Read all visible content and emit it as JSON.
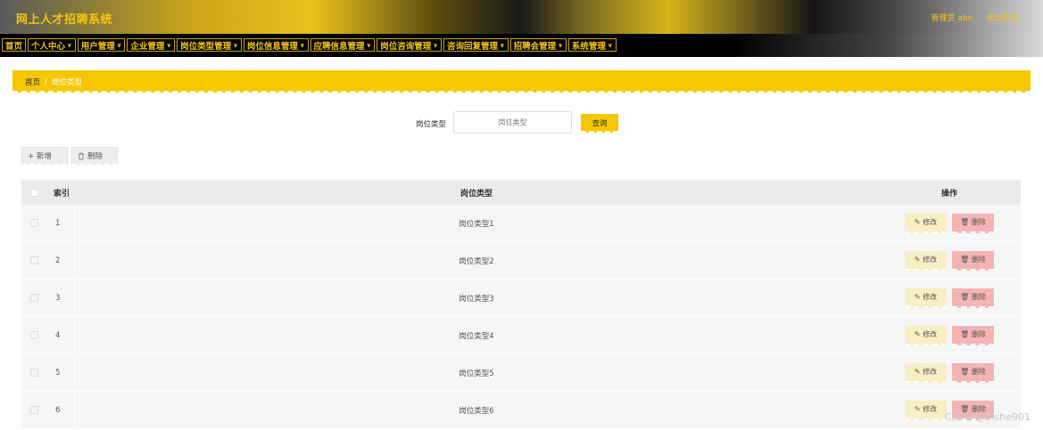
{
  "header": {
    "brand": "网上人才招聘系统",
    "user_label": "管理员 abo",
    "logout": "退出登录"
  },
  "nav": [
    {
      "label": "首页",
      "has_menu": false
    },
    {
      "label": "个人中心",
      "has_menu": true
    },
    {
      "label": "用户管理",
      "has_menu": true
    },
    {
      "label": "企业管理",
      "has_menu": true
    },
    {
      "label": "岗位类型管理",
      "has_menu": true
    },
    {
      "label": "岗位信息管理",
      "has_menu": true
    },
    {
      "label": "应聘信息管理",
      "has_menu": true
    },
    {
      "label": "岗位咨询管理",
      "has_menu": true
    },
    {
      "label": "咨询回复管理",
      "has_menu": true
    },
    {
      "label": "招聘会管理",
      "has_menu": true
    },
    {
      "label": "系统管理",
      "has_menu": true
    }
  ],
  "breadcrumb": {
    "home": "首页",
    "separator": "/",
    "current": "岗位类型"
  },
  "search": {
    "label": "岗位类型",
    "placeholder": "岗位类型",
    "button": "查询"
  },
  "toolbar": {
    "add_label": "+ 新增",
    "delete_label": "删除"
  },
  "table": {
    "headers": {
      "index": "索引",
      "type": "岗位类型",
      "ops": "操作"
    },
    "rows": [
      {
        "index": "1",
        "type": "岗位类型1"
      },
      {
        "index": "2",
        "type": "岗位类型2"
      },
      {
        "index": "3",
        "type": "岗位类型3"
      },
      {
        "index": "4",
        "type": "岗位类型4"
      },
      {
        "index": "5",
        "type": "岗位类型5"
      },
      {
        "index": "6",
        "type": "岗位类型6"
      }
    ],
    "edit_label": "修改",
    "delete_label": "删除"
  },
  "watermark": "CSDN @bishe901",
  "colors": {
    "accent": "#f6c700",
    "edit": "#faeec4",
    "delete": "#f5b4b4"
  },
  "icons": {
    "edit": "pencil-icon",
    "delete": "trash-icon",
    "menu": "chevron-down-icon"
  }
}
